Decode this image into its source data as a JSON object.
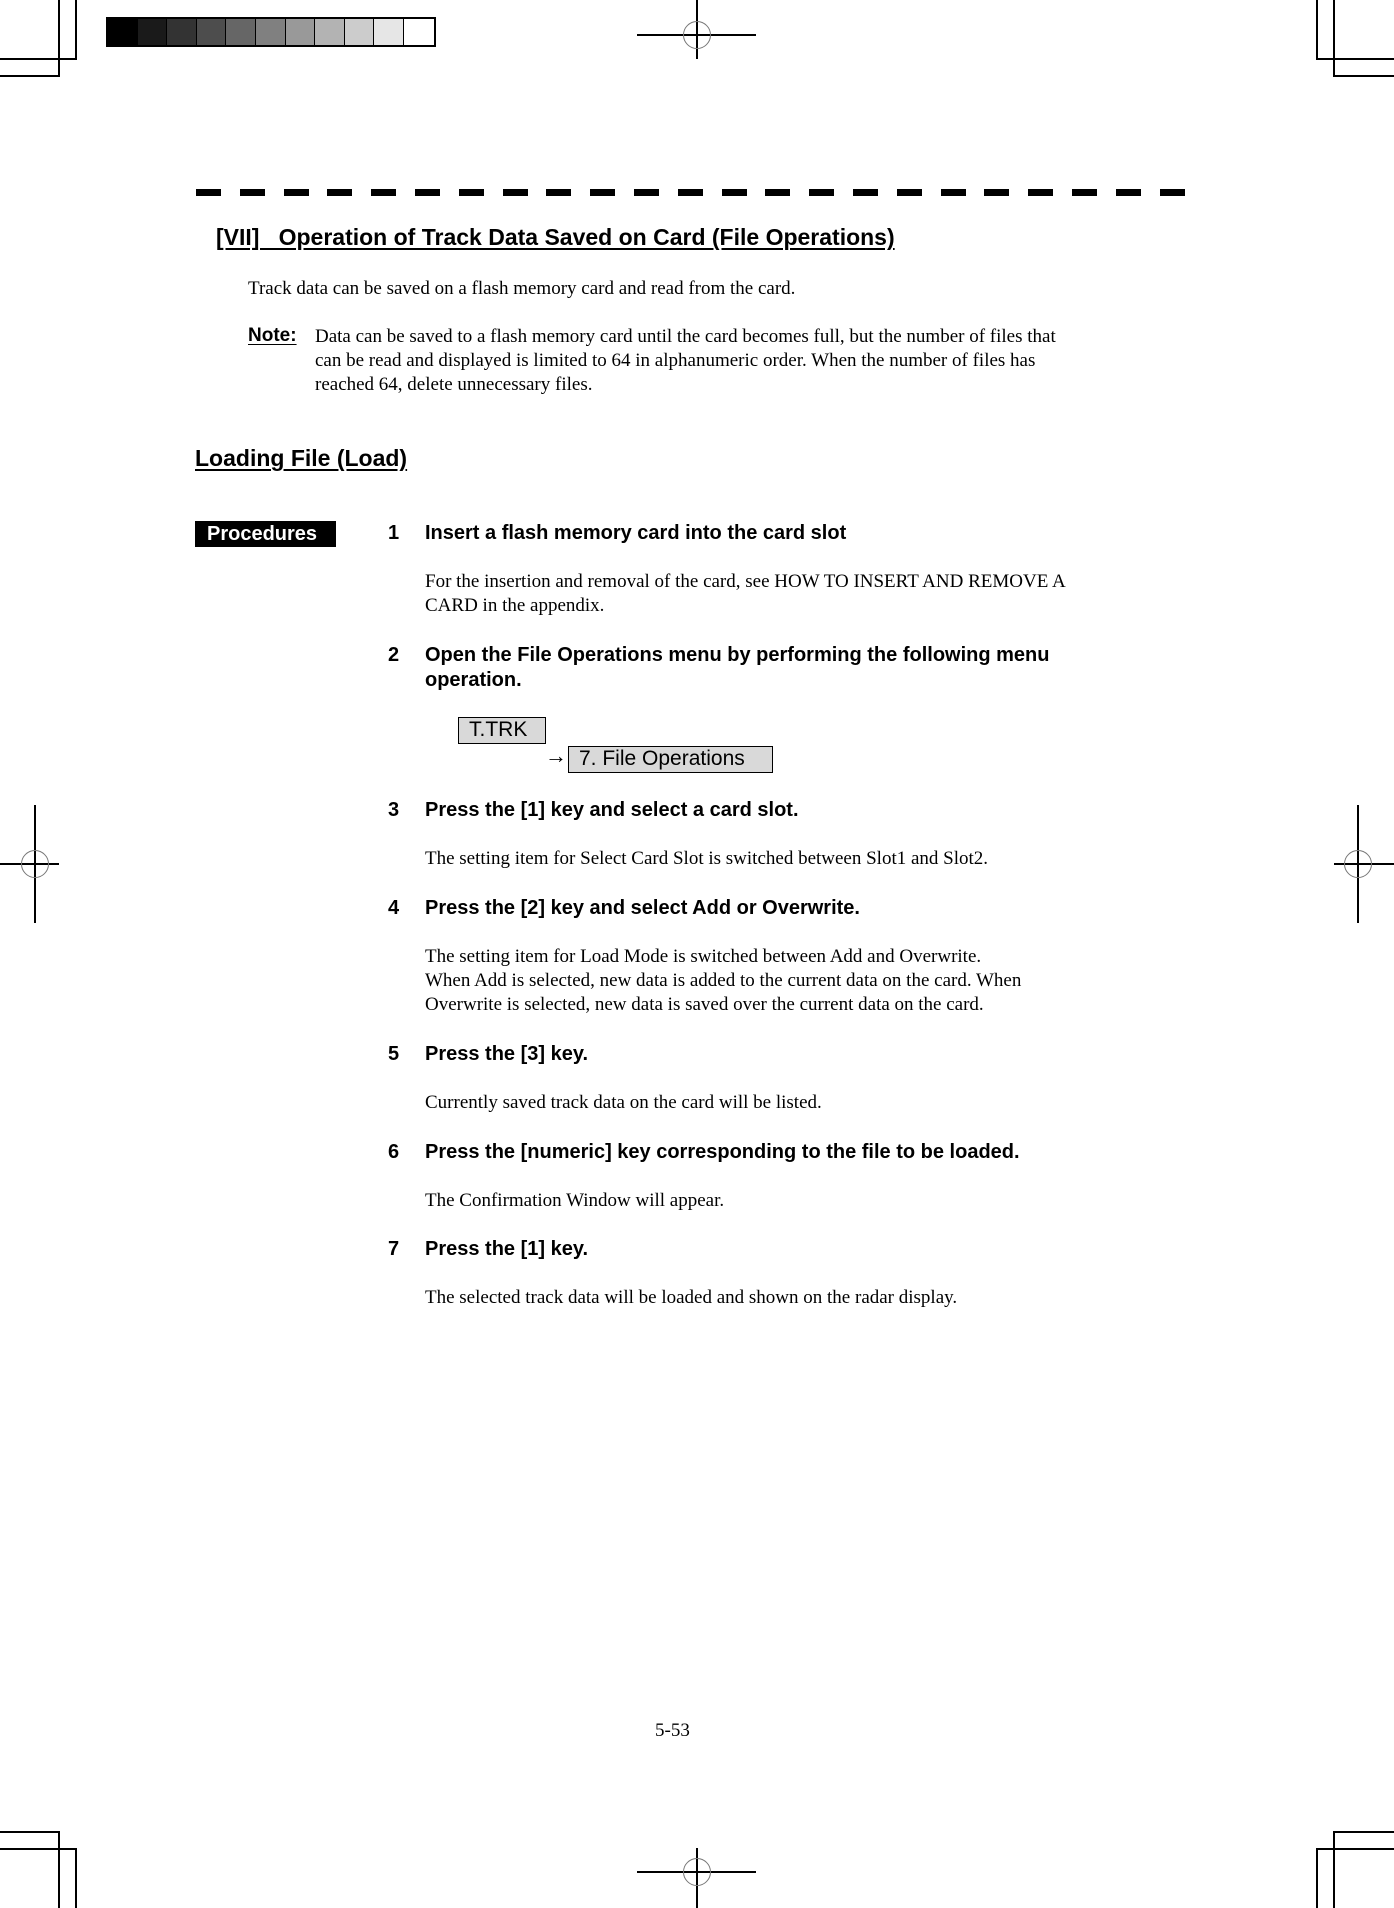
{
  "header": {
    "section_title": "[VII]   Operation of Track Data Saved on Card (File Operations)",
    "intro": "Track data can be saved on a flash memory card and read from the card."
  },
  "note": {
    "label": "Note:",
    "lines": [
      "Data can be saved to a flash memory card until the card becomes full, but the number of files that",
      "can be read and displayed is limited to 64 in alphanumeric order.    When the number of files has",
      "reached 64, delete unnecessary files."
    ]
  },
  "subsection": {
    "title": "Loading File (Load)",
    "badge": "Procedures"
  },
  "steps": [
    {
      "num": "1",
      "title_lines": [
        "Insert a flash memory card into the card slot"
      ],
      "desc_lines": [
        "For the insertion and removal of the card, see HOW TO INSERT AND REMOVE A",
        "CARD in the appendix."
      ]
    },
    {
      "num": "2",
      "title_lines": [
        "Open the File Operations menu by performing the following menu",
        "operation."
      ],
      "desc_lines": []
    },
    {
      "num": "3",
      "title_lines": [
        "Press the [1] key and select a card slot."
      ],
      "desc_lines": [
        "The setting item for Select Card Slot is switched between Slot1 and Slot2."
      ]
    },
    {
      "num": "4",
      "title_lines": [
        "Press the [2] key and select Add or Overwrite."
      ],
      "desc_lines": [
        "The setting item for Load Mode is switched between Add and Overwrite.",
        "When Add is selected, new data is added to the current data on the card.    When",
        "Overwrite is selected, new data is saved over the current data on the card."
      ]
    },
    {
      "num": "5",
      "title_lines": [
        "Press the [3] key."
      ],
      "desc_lines": [
        "Currently saved track data on the card will be listed."
      ]
    },
    {
      "num": "6",
      "title_lines": [
        "Press the [numeric] key corresponding to the file to be loaded."
      ],
      "desc_lines": [
        "The Confirmation Window will appear."
      ]
    },
    {
      "num": "7",
      "title_lines": [
        "Press the [1] key."
      ],
      "desc_lines": [
        "The selected track data will be loaded and shown on the radar display."
      ]
    }
  ],
  "menu_path": {
    "key1": "T.TRK",
    "arrow": "→",
    "key2": "7. File Operations"
  },
  "footer": {
    "page_number": "5-53"
  },
  "gray_scale": [
    "#000000",
    "#1a1a1a",
    "#333333",
    "#4d4d4d",
    "#666666",
    "#808080",
    "#999999",
    "#b3b3b3",
    "#cccccc",
    "#e6e6e6",
    "#ffffff"
  ]
}
